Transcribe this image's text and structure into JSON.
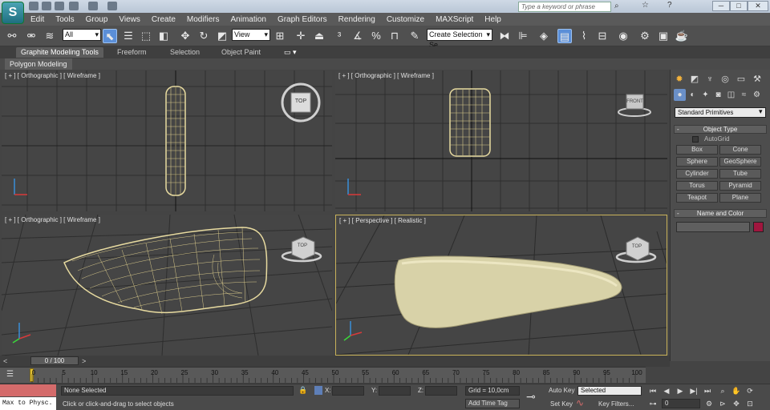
{
  "app": {
    "logo_text": "S",
    "search_placeholder": "Type a keyword or phrase",
    "window_buttons": [
      "─",
      "□",
      "✕"
    ]
  },
  "menu": [
    "Edit",
    "Tools",
    "Group",
    "Views",
    "Create",
    "Modifiers",
    "Animation",
    "Graph Editors",
    "Rendering",
    "Customize",
    "MAXScript",
    "Help"
  ],
  "toolbar": {
    "filter_value": "All",
    "coord_system_value": "View",
    "selection_set_value": "Create Selection Se"
  },
  "ribbon": {
    "tabs": [
      {
        "label": "Graphite Modeling Tools",
        "active": true
      },
      {
        "label": "Freeform",
        "active": false
      },
      {
        "label": "Selection",
        "active": false
      },
      {
        "label": "Object Paint",
        "active": false
      }
    ],
    "panel_label": "Polygon Modeling"
  },
  "viewports": {
    "top_left": {
      "label": "[ + ] [ Orthographic ] [ Wireframe ]",
      "cube_label": "TOP"
    },
    "top_right": {
      "label": "[ + ] [ Orthographic ] [ Wireframe ]",
      "cube_label": "FRONT"
    },
    "bottom_left": {
      "label": "[ + ] [ Orthographic ] [ Wireframe ]",
      "cube_label": "TOP"
    },
    "bottom_right": {
      "label": "[ + ] [ Perspective ] [ Realistic ]",
      "cube_label": "TOP"
    }
  },
  "command_panel": {
    "dropdown_value": "Standard Primitives",
    "object_type_title": "Object Type",
    "autogrid_label": "AutoGrid",
    "primitives": [
      "Box",
      "Cone",
      "Sphere",
      "GeoSphere",
      "Cylinder",
      "Tube",
      "Torus",
      "Pyramid",
      "Teapot",
      "Plane"
    ],
    "name_color_title": "Name and Color",
    "color_swatch": "#a0163e"
  },
  "timeline": {
    "slider_text": "0 / 100",
    "ticks": [
      "0",
      "5",
      "10",
      "15",
      "20",
      "25",
      "30",
      "35",
      "40",
      "45",
      "50",
      "55",
      "60",
      "65",
      "70",
      "75",
      "80",
      "85",
      "90",
      "95",
      "100"
    ]
  },
  "status": {
    "script_listener": "Max to Physc.",
    "selection_status": "None Selected",
    "prompt": "Click or click-and-drag to select objects",
    "x_label": "X:",
    "y_label": "Y:",
    "z_label": "Z:",
    "grid": "Grid = 10,0cm",
    "add_time_tag": "Add Time Tag",
    "auto_key": "Auto Key",
    "set_key": "Set Key",
    "key_mode_value": "Selected",
    "key_filters": "Key Filters...",
    "frame_value": "0",
    "accent_color": "#d46b6b"
  }
}
